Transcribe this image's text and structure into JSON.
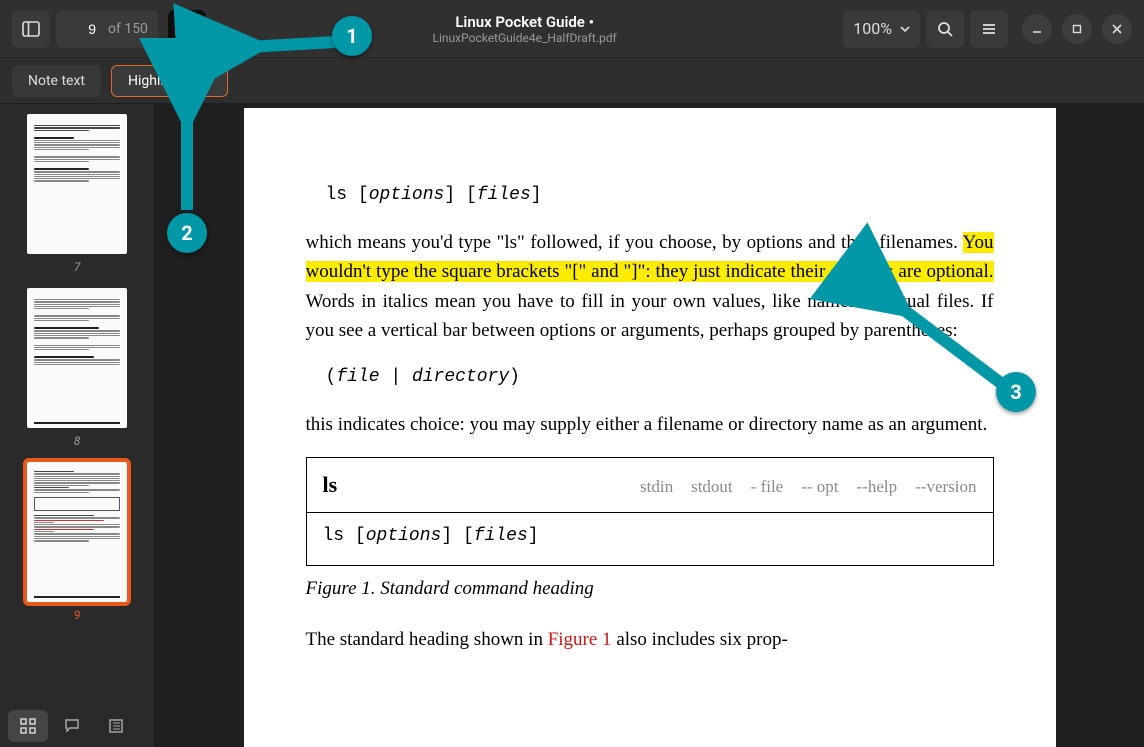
{
  "header": {
    "page_value": "9",
    "page_total": "of 150",
    "title": "Linux Pocket Guide •",
    "subtitle": "LinuxPocketGuide4e_HalfDraft.pdf",
    "zoom": "100%"
  },
  "subbar": {
    "note_label": "Note text",
    "highlight_label": "Highlight text"
  },
  "thumbnails": [
    {
      "num": "7",
      "selected": false
    },
    {
      "num": "8",
      "selected": false
    },
    {
      "num": "9",
      "selected": true
    }
  ],
  "doc": {
    "code1_pre": "ls [",
    "code1_opt": "options",
    "code1_mid": "] [",
    "code1_files": "files",
    "code1_end": "]",
    "para1_a": "which means you'd type \"ls\" followed, if you choose, by options and then filenames. ",
    "para1_hl": "You wouldn't type the square brackets \"[\" and \"]\": they just indicate their contents are optional.",
    "para1_b": " Words in italics mean you have to fill in your own values, like names of actual files. If you see a vertical bar between options or arguments, perhaps grouped by parentheses:",
    "code2_pre": "(",
    "code2_a": "file",
    "code2_mid": " | ",
    "code2_b": "directory",
    "code2_end": ")",
    "para2": "this indicates choice: you may supply either a filename or directory name as an argument.",
    "box_name": "ls",
    "box_opts": [
      "stdin",
      "stdout",
      "- file",
      "-- opt",
      "--help",
      "--version"
    ],
    "box_syntax_pre": "ls [",
    "box_syntax_a": "options",
    "box_syntax_mid": "] [",
    "box_syntax_b": "files",
    "box_syntax_end": "]",
    "figcap": "Figure 1. Standard command heading",
    "para3_a": "The standard heading shown in ",
    "para3_link": "Figure 1",
    "para3_b": " also includes six prop‐"
  },
  "callouts": {
    "c1": "1",
    "c2": "2",
    "c3": "3"
  }
}
